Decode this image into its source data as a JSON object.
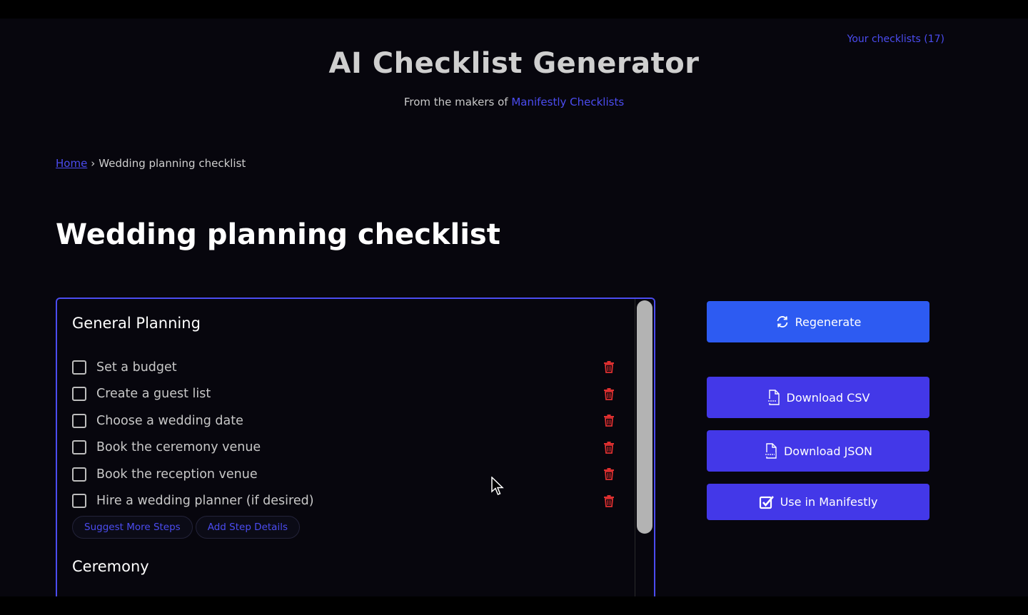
{
  "header": {
    "checklists_link": "Your checklists (17)",
    "title": "AI Checklist Generator",
    "subtitle_prefix": "From the makers of",
    "subtitle_link": "Manifestly Checklists"
  },
  "breadcrumb": {
    "home": "Home",
    "separator": "›",
    "current": "Wedding planning checklist"
  },
  "page_title": "Wedding planning checklist",
  "checklist": {
    "sections": [
      {
        "title": "General Planning",
        "items": [
          {
            "label": "Set a budget",
            "checked": false
          },
          {
            "label": "Create a guest list",
            "checked": false
          },
          {
            "label": "Choose a wedding date",
            "checked": false
          },
          {
            "label": "Book the ceremony venue",
            "checked": false
          },
          {
            "label": "Book the reception venue",
            "checked": false
          },
          {
            "label": "Hire a wedding planner (if desired)",
            "checked": false
          }
        ],
        "actions": {
          "suggest_more": "Suggest More Steps",
          "add_details": "Add Step Details"
        }
      },
      {
        "title": "Ceremony",
        "items": []
      }
    ]
  },
  "sidebar": {
    "regenerate": "Regenerate",
    "download_csv": "Download CSV",
    "download_json": "Download JSON",
    "use_in_manifestly": "Use in Manifestly"
  },
  "icons": {
    "regenerate": "refresh-icon",
    "csv": "csv-file-icon",
    "json": "json-file-icon",
    "use": "checkbox-icon",
    "delete": "trash-icon"
  },
  "colors": {
    "accent": "#4b4cf0",
    "regenerate_button": "#2d5bf2",
    "action_button": "#4338e8",
    "delete_icon": "#e03030",
    "background": "#07060d"
  }
}
